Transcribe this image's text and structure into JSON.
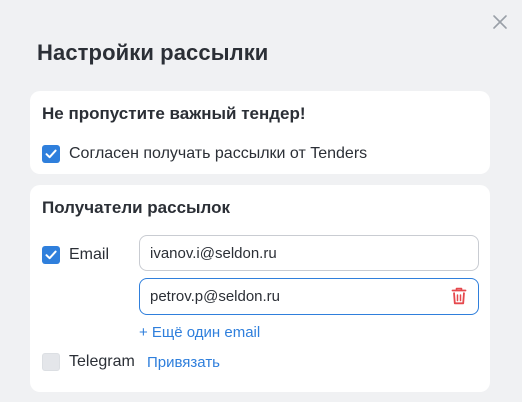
{
  "dialog": {
    "title": "Настройки рассылки"
  },
  "tender_section": {
    "title": "Не пропустите важный тендер!",
    "consent_label": "Согласен получать рассылки от Tenders",
    "consent_checked": true
  },
  "recipients_section": {
    "title": "Получатели рассылок",
    "email_label": "Email",
    "email_checked": true,
    "emails": [
      "ivanov.i@seldon.ru",
      "petrov.p@seldon.ru"
    ],
    "add_email_label": "+ Ещё один email",
    "telegram_label": "Telegram",
    "telegram_checked": false,
    "telegram_link_label": "Привязать"
  },
  "colors": {
    "accent": "#2f7fdc",
    "delete": "#e5484d",
    "background": "#f0f1f3",
    "card": "#ffffff"
  },
  "icons": [
    "close-icon",
    "check-icon",
    "trash-icon"
  ]
}
